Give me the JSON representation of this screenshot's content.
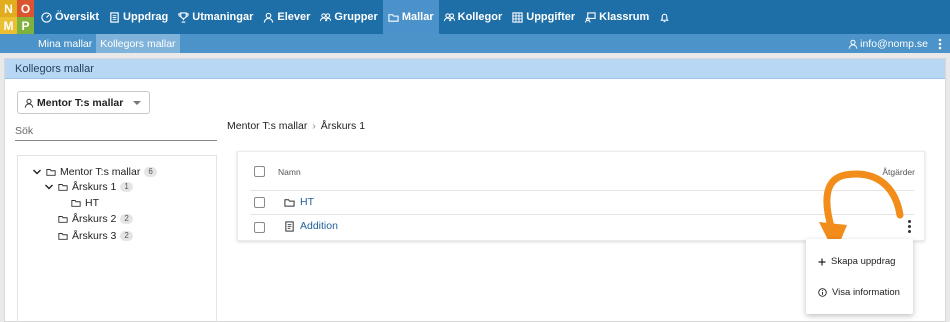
{
  "logo": {
    "letters": [
      "N",
      "O",
      "M",
      "P"
    ],
    "colors": [
      "#e1ad1f",
      "#d9542f",
      "#eabf32",
      "#7fb23d"
    ]
  },
  "nav": {
    "items": [
      {
        "label": "Översikt",
        "icon": "dashboard-icon"
      },
      {
        "label": "Uppdrag",
        "icon": "document-icon"
      },
      {
        "label": "Utmaningar",
        "icon": "trophy-icon"
      },
      {
        "label": "Elever",
        "icon": "user-icon"
      },
      {
        "label": "Grupper",
        "icon": "users-icon"
      },
      {
        "label": "Mallar",
        "icon": "folder-icon",
        "active": true
      },
      {
        "label": "Kollegor",
        "icon": "users-icon"
      },
      {
        "label": "Uppgifter",
        "icon": "grid-icon"
      },
      {
        "label": "Klassrum",
        "icon": "classroom-icon"
      }
    ],
    "bell_icon": "bell-icon"
  },
  "subnav": {
    "tabs": [
      {
        "label": "Mina mallar"
      },
      {
        "label": "Kollegors mallar",
        "active": true
      }
    ],
    "user_email": "info@nomp.se"
  },
  "section": {
    "title": "Kollegors mallar"
  },
  "colleague_select": {
    "value": "Mentor T:s mallar"
  },
  "search": {
    "placeholder": "Sök"
  },
  "tree": {
    "root": {
      "label": "Mentor T:s mallar",
      "count": "6"
    },
    "children": [
      {
        "label": "Årskurs 1",
        "count": "1"
      },
      {
        "label": "HT"
      },
      {
        "label": "Årskurs 2",
        "count": "2"
      },
      {
        "label": "Årskurs 3",
        "count": "2"
      }
    ]
  },
  "breadcrumb": {
    "root": "Mentor T:s mallar",
    "current": "Årskurs 1"
  },
  "table": {
    "headers": {
      "name": "Namn",
      "actions": "Åtgärder"
    },
    "rows": [
      {
        "name": "HT",
        "icon": "folder-icon"
      },
      {
        "name": "Addition",
        "icon": "template-icon"
      }
    ]
  },
  "context_menu": {
    "items": [
      {
        "label": "Skapa uppdrag",
        "icon": "plus-icon"
      },
      {
        "label": "Visa information",
        "icon": "info-icon"
      }
    ]
  },
  "colors": {
    "topbar": "#1e6ea8",
    "accent_arrow": "#f28c1a",
    "link": "#1e5f9a"
  }
}
